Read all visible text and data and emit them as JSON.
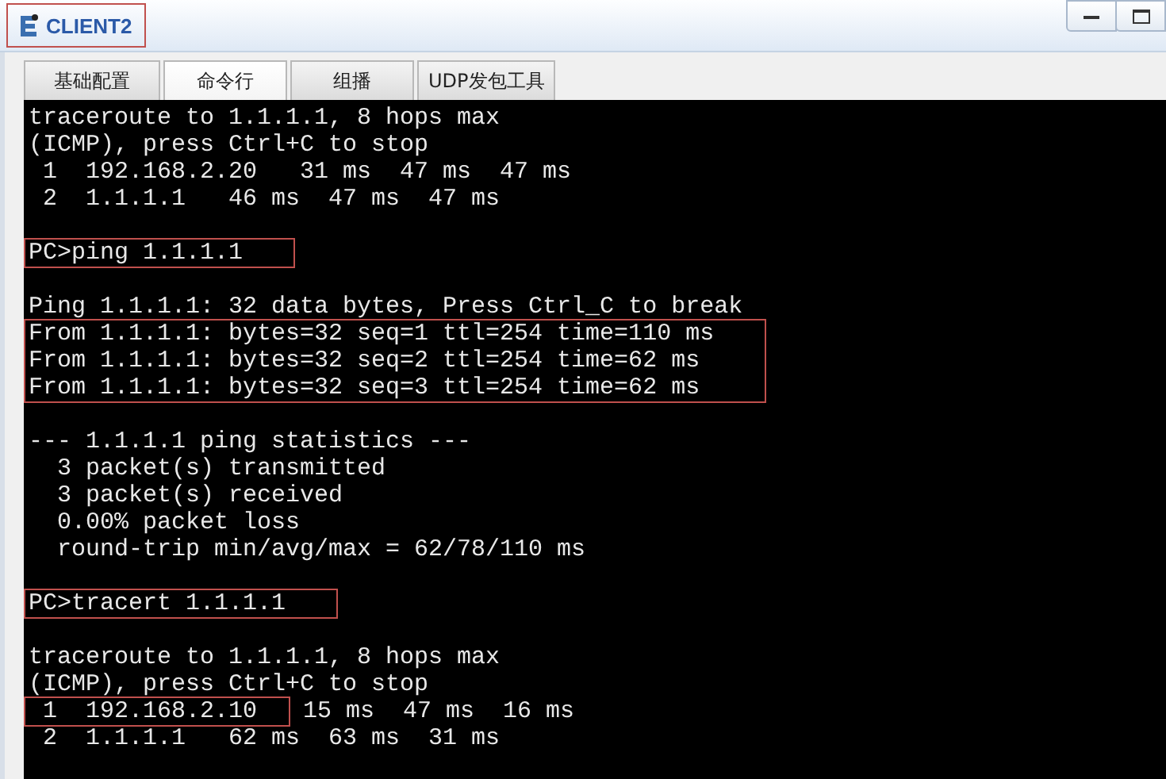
{
  "window": {
    "title": "CLIENT2",
    "title_highlighted": true,
    "controls": [
      {
        "kind": "minimize"
      },
      {
        "kind": "maximize"
      }
    ]
  },
  "tabs": [
    {
      "label": "基础配置",
      "selected": false
    },
    {
      "label": "命令行",
      "selected": true
    },
    {
      "label": "组播",
      "selected": false
    },
    {
      "label": "UDP发包工具",
      "selected": false
    }
  ],
  "terminal": {
    "blocks": [
      {
        "blank_before": false,
        "highlighted": false,
        "lines": [
          [
            {
              "text": "traceroute to 1.1.1.1, 8 hops max",
              "highlighted": false
            }
          ],
          [
            {
              "text": "(ICMP), press Ctrl+C to stop",
              "highlighted": false
            }
          ],
          [
            {
              "text": " 1  192.168.2.20   31 ms  47 ms  47 ms",
              "highlighted": false
            }
          ],
          [
            {
              "text": " 2  1.1.1.1   46 ms  47 ms  47 ms",
              "highlighted": false
            }
          ]
        ]
      },
      {
        "blank_before": true,
        "highlighted": true,
        "lines": [
          [
            {
              "text": "PC>ping 1.1.1.1",
              "highlighted": false
            }
          ]
        ]
      },
      {
        "blank_before": true,
        "highlighted": false,
        "lines": [
          [
            {
              "text": "Ping 1.1.1.1: 32 data bytes, Press Ctrl_C to break",
              "highlighted": false
            }
          ]
        ]
      },
      {
        "blank_before": false,
        "highlighted": true,
        "lines": [
          [
            {
              "text": "From 1.1.1.1: bytes=32 seq=1 ttl=254 time=110 ms",
              "highlighted": false
            }
          ],
          [
            {
              "text": "From 1.1.1.1: bytes=32 seq=2 ttl=254 time=62 ms",
              "highlighted": false
            }
          ],
          [
            {
              "text": "From 1.1.1.1: bytes=32 seq=3 ttl=254 time=62 ms",
              "highlighted": false
            }
          ]
        ]
      },
      {
        "blank_before": true,
        "highlighted": false,
        "lines": [
          [
            {
              "text": "--- 1.1.1.1 ping statistics ---",
              "highlighted": false
            }
          ],
          [
            {
              "text": "  3 packet(s) transmitted",
              "highlighted": false
            }
          ],
          [
            {
              "text": "  3 packet(s) received",
              "highlighted": false
            }
          ],
          [
            {
              "text": "  0.00% packet loss",
              "highlighted": false
            }
          ],
          [
            {
              "text": "  round-trip min/avg/max = 62/78/110 ms",
              "highlighted": false
            }
          ]
        ]
      },
      {
        "blank_before": true,
        "highlighted": true,
        "lines": [
          [
            {
              "text": "PC>tracert 1.1.1.1",
              "highlighted": false
            }
          ]
        ]
      },
      {
        "blank_before": true,
        "highlighted": false,
        "lines": [
          [
            {
              "text": "traceroute to 1.1.1.1, 8 hops max",
              "highlighted": false
            }
          ],
          [
            {
              "text": "(ICMP), press Ctrl+C to stop",
              "highlighted": false
            }
          ],
          [
            {
              "text": " 1  192.168.2.10",
              "highlighted": true
            },
            {
              "text": "15 ms  47 ms  16 ms",
              "highlighted": false
            }
          ],
          [
            {
              "text": " 2  1.1.1.1   62 ms  63 ms  31 ms",
              "highlighted": false
            }
          ]
        ]
      }
    ]
  }
}
